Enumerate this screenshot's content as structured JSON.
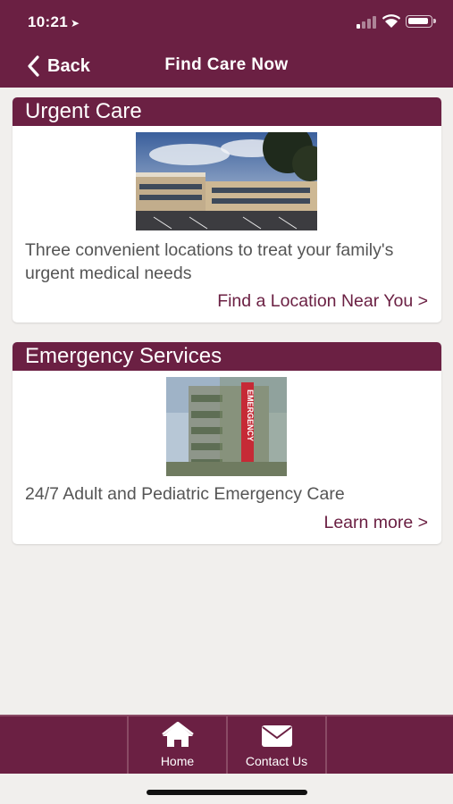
{
  "status_bar": {
    "time": "10:21",
    "location_arrow": "location-arrow-icon"
  },
  "nav": {
    "back_label": "Back",
    "title": "Find Care Now"
  },
  "cards": [
    {
      "title": "Urgent Care",
      "description": "Three convenient locations to treat your family's urgent medical needs",
      "link": "Find a Location Near You >"
    },
    {
      "title": "Emergency Services",
      "description": "24/7 Adult and Pediatric Emergency Care",
      "link": "Learn more >",
      "sign_text": "EMERGENCY"
    }
  ],
  "tabs": [
    {
      "label": "Home",
      "icon": "home-icon"
    },
    {
      "label": "Contact Us",
      "icon": "envelope-icon"
    }
  ],
  "colors": {
    "brand": "#6b2043",
    "background": "#f1efed"
  }
}
